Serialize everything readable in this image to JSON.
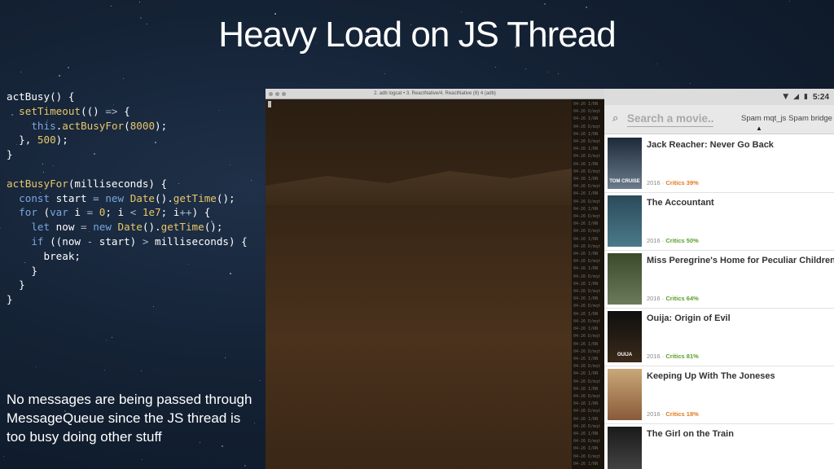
{
  "slide": {
    "title": "Heavy Load on JS Thread",
    "note": "No messages are being passed through MessageQueue since the JS thread is too busy doing other stuff"
  },
  "code": {
    "lines": [
      "actBusy() {",
      "  setTimeout(() => {",
      "    this.actBusyFor(8000);",
      "  }, 500);",
      "}",
      "",
      "actBusyFor(milliseconds) {",
      "  const start = new Date().getTime();",
      "  for (var i = 0; i < 1e7; i++) {",
      "    let now = new Date().getTime();",
      "    if ((now - start) > milliseconds) {",
      "      break;",
      "    }",
      "  }",
      "}"
    ]
  },
  "terminal": {
    "title": "2. adb logcat • 3. ReactNative/4. ReactNative (8) 4 (adb)"
  },
  "phone": {
    "status": {
      "time": "5:24",
      "wifi_icon": "wifi-icon",
      "signal_icon": "signal-icon",
      "battery_icon": "battery-icon"
    },
    "search_placeholder": "Search a movie...",
    "spam_text": "Spam mqt_js Spam bridge",
    "movies": [
      {
        "title": "Jack Reacher: Never Go Back",
        "year": "2016",
        "critics": "Critics 39%",
        "critics_color": "#e07a1f",
        "poster_colors": [
          "#1d2a38",
          "#6b7b8c"
        ],
        "poster_label": "TOM CRUISE"
      },
      {
        "title": "The Accountant",
        "year": "2016",
        "critics": "Critics 50%",
        "critics_color": "#5aa02c",
        "poster_colors": [
          "#2b4a5a",
          "#4b7a8a"
        ],
        "poster_label": ""
      },
      {
        "title": "Miss Peregrine's Home for Peculiar Children",
        "year": "2016",
        "critics": "Critics 64%",
        "critics_color": "#5aa02c",
        "poster_colors": [
          "#3a4a2a",
          "#6a7a5a"
        ],
        "poster_label": ""
      },
      {
        "title": "Ouija: Origin of Evil",
        "year": "2016",
        "critics": "Critics 81%",
        "critics_color": "#5aa02c",
        "poster_colors": [
          "#0f0f0f",
          "#3a2a1a"
        ],
        "poster_label": "OUIJA"
      },
      {
        "title": "Keeping Up With The Joneses",
        "year": "2016",
        "critics": "Critics 18%",
        "critics_color": "#e07a1f",
        "poster_colors": [
          "#c8a878",
          "#8a5a3a"
        ],
        "poster_label": ""
      },
      {
        "title": "The Girl on the Train",
        "year": "",
        "critics": "",
        "critics_color": "#5aa02c",
        "poster_colors": [
          "#1a1a1a",
          "#4a4a4a"
        ],
        "poster_label": ""
      }
    ]
  }
}
